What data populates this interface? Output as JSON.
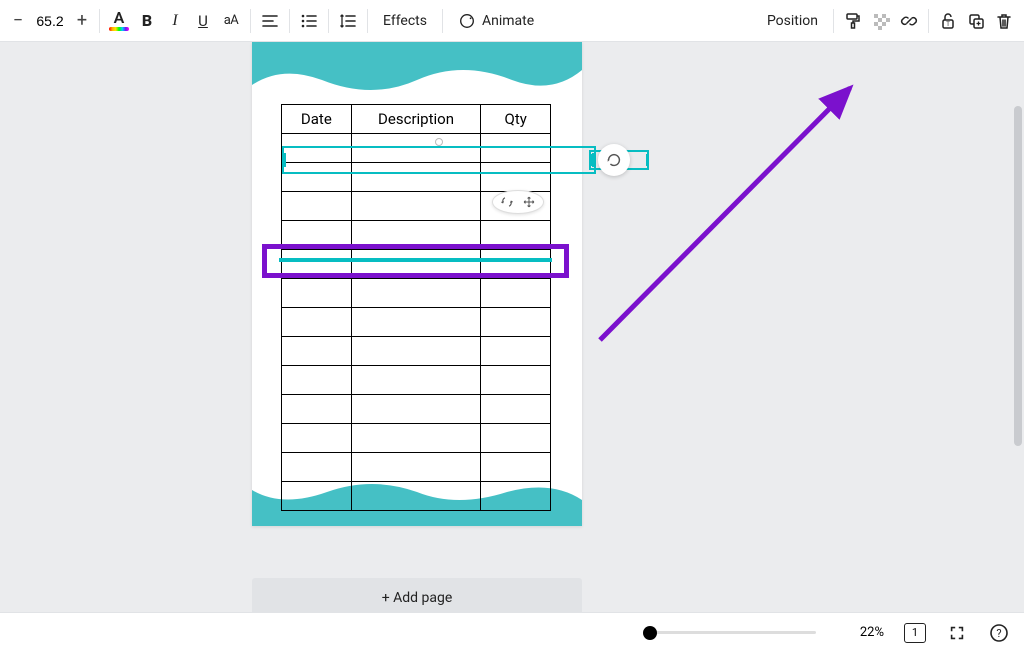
{
  "toolbar": {
    "font_size": "65.2",
    "effects_label": "Effects",
    "animate_label": "Animate",
    "position_label": "Position"
  },
  "table": {
    "headers": [
      "Date",
      "Description",
      "Qty"
    ],
    "row_count": 13
  },
  "canvas": {
    "add_page_label": "+ Add page"
  },
  "status": {
    "zoom_pct": "22%",
    "page_number": "1"
  }
}
